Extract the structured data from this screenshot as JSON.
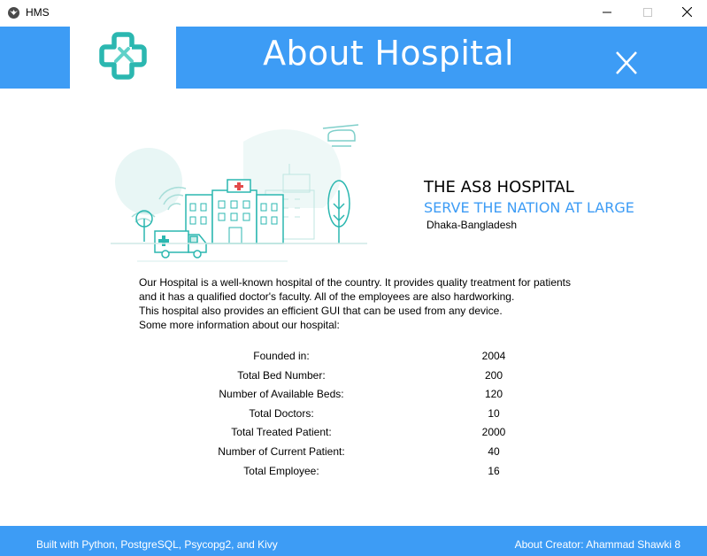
{
  "window": {
    "title": "HMS",
    "minimize_icon": "minimize-icon",
    "maximize_icon": "maximize-icon",
    "close_icon": "close-icon"
  },
  "header": {
    "title": "About Hospital",
    "logo_icon": "medical-cross-logo-icon",
    "close_icon": "close-x-icon"
  },
  "hero": {
    "illustration": "hospital-illustration",
    "name": "THE AS8 HOSPITAL",
    "tagline": "SERVE THE NATION AT LARGE",
    "location": "Dhaka-Bangladesh"
  },
  "description": [
    "Our Hospital is a well-known hospital of the country. It provides quality treatment for patients",
    "and it has a qualified doctor's faculty. All of the employees are also hardworking.",
    "This hospital also provides an efficient GUI that can be used from any device.",
    "Some more information about our hospital:"
  ],
  "stats": [
    {
      "label": "Founded in:",
      "value": "2004"
    },
    {
      "label": "Total Bed Number:",
      "value": "200"
    },
    {
      "label": "Number of Available Beds:",
      "value": "120"
    },
    {
      "label": "Total Doctors:",
      "value": "10"
    },
    {
      "label": "Total Treated Patient:",
      "value": "2000"
    },
    {
      "label": "Number of Current Patient:",
      "value": "40"
    },
    {
      "label": "Total Employee:",
      "value": "16"
    }
  ],
  "footer": {
    "left": "Built with Python, PostgreSQL, Psycopg2, and Kivy",
    "right": "About Creator: Ahammad Shawki 8"
  },
  "colors": {
    "accent": "#3d9cf5",
    "logo": "#2bb7b0",
    "background": "#ffffff"
  }
}
